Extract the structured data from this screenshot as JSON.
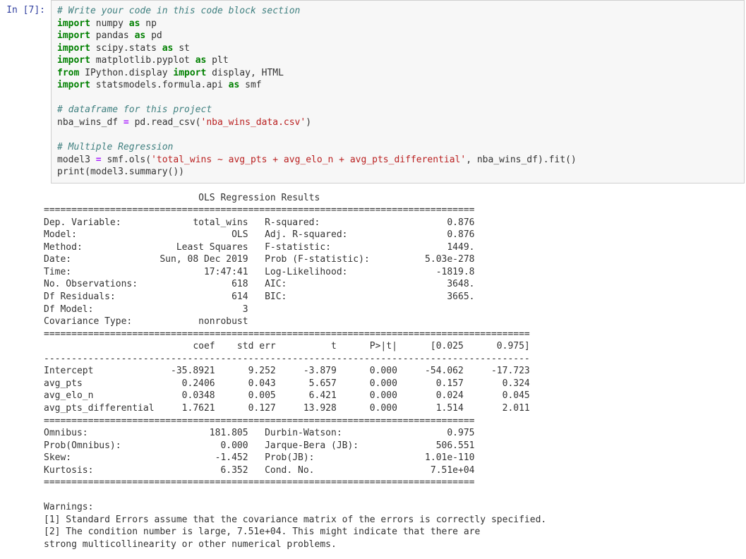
{
  "cell": {
    "prompt": "In [7]:",
    "code": {
      "l1_comment": "# Write your code in this code block section",
      "l2_kw1": "import",
      "l2_mod": "numpy",
      "l2_kw2": "as",
      "l2_alias": "np",
      "l3_kw1": "import",
      "l3_mod": "pandas",
      "l3_kw2": "as",
      "l3_alias": "pd",
      "l4_kw1": "import",
      "l4_mod": "scipy.stats",
      "l4_kw2": "as",
      "l4_alias": "st",
      "l5_kw1": "import",
      "l5_mod": "matplotlib.pyplot",
      "l5_kw2": "as",
      "l5_alias": "plt",
      "l6_kw1": "from",
      "l6_mod": "IPython.display",
      "l6_kw2": "import",
      "l6_names": "display, HTML",
      "l7_kw1": "import",
      "l7_mod": "statsmodels.formula.api",
      "l7_kw2": "as",
      "l7_alias": "smf",
      "l9_comment": "# dataframe for this project",
      "l10_var": "nba_wins_df ",
      "l10_eq": "=",
      "l10_call": " pd.read_csv(",
      "l10_str": "'nba_wins_data.csv'",
      "l10_end": ")",
      "l12_comment": "# Multiple Regression",
      "l13_var": "model3 ",
      "l13_eq": "=",
      "l13_call": " smf.ols(",
      "l13_str": "'total_wins ~ avg_pts + avg_elo_n + avg_pts_differential'",
      "l13_mid": ", nba_wins_df).fit()",
      "l14": "print(model3.summary())"
    }
  },
  "output": {
    "text": "                            OLS Regression Results                            \n==============================================================================\nDep. Variable:             total_wins   R-squared:                       0.876\nModel:                            OLS   Adj. R-squared:                  0.876\nMethod:                 Least Squares   F-statistic:                     1449.\nDate:                Sun, 08 Dec 2019   Prob (F-statistic):          5.03e-278\nTime:                        17:47:41   Log-Likelihood:                -1819.8\nNo. Observations:                 618   AIC:                             3648.\nDf Residuals:                     614   BIC:                             3665.\nDf Model:                           3                                         \nCovariance Type:            nonrobust                                         \n========================================================================================\n                           coef    std err          t      P>|t|      [0.025      0.975]\n----------------------------------------------------------------------------------------\nIntercept              -35.8921      9.252     -3.879      0.000     -54.062     -17.723\navg_pts                  0.2406      0.043      5.657      0.000       0.157       0.324\navg_elo_n                0.0348      0.005      6.421      0.000       0.024       0.045\navg_pts_differential     1.7621      0.127     13.928      0.000       1.514       2.011\n==============================================================================\nOmnibus:                      181.805   Durbin-Watson:                   0.975\nProb(Omnibus):                  0.000   Jarque-Bera (JB):              506.551\nSkew:                          -1.452   Prob(JB):                    1.01e-110\nKurtosis:                       6.352   Cond. No.                     7.51e+04\n==============================================================================\n\nWarnings:\n[1] Standard Errors assume that the covariance matrix of the errors is correctly specified.\n[2] The condition number is large, 7.51e+04. This might indicate that there are\nstrong multicollinearity or other numerical problems."
  },
  "chart_data": {
    "type": "table",
    "title": "OLS Regression Results",
    "model_summary": {
      "Dep. Variable": "total_wins",
      "Model": "OLS",
      "Method": "Least Squares",
      "Date": "Sun, 08 Dec 2019",
      "Time": "17:47:41",
      "No. Observations": 618,
      "Df Residuals": 614,
      "Df Model": 3,
      "Covariance Type": "nonrobust",
      "R-squared": 0.876,
      "Adj. R-squared": 0.876,
      "F-statistic": 1449.0,
      "Prob (F-statistic)": "5.03e-278",
      "Log-Likelihood": -1819.8,
      "AIC": 3648.0,
      "BIC": 3665.0
    },
    "coefficients": {
      "columns": [
        "coef",
        "std err",
        "t",
        "P>|t|",
        "[0.025",
        "0.975]"
      ],
      "rows": [
        {
          "name": "Intercept",
          "coef": -35.8921,
          "std_err": 9.252,
          "t": -3.879,
          "p": 0.0,
          "ci_low": -54.062,
          "ci_high": -17.723
        },
        {
          "name": "avg_pts",
          "coef": 0.2406,
          "std_err": 0.043,
          "t": 5.657,
          "p": 0.0,
          "ci_low": 0.157,
          "ci_high": 0.324
        },
        {
          "name": "avg_elo_n",
          "coef": 0.0348,
          "std_err": 0.005,
          "t": 6.421,
          "p": 0.0,
          "ci_low": 0.024,
          "ci_high": 0.045
        },
        {
          "name": "avg_pts_differential",
          "coef": 1.7621,
          "std_err": 0.127,
          "t": 13.928,
          "p": 0.0,
          "ci_low": 1.514,
          "ci_high": 2.011
        }
      ]
    },
    "diagnostics": {
      "Omnibus": 181.805,
      "Prob(Omnibus)": 0.0,
      "Skew": -1.452,
      "Kurtosis": 6.352,
      "Durbin-Watson": 0.975,
      "Jarque-Bera (JB)": 506.551,
      "Prob(JB)": "1.01e-110",
      "Cond. No.": "7.51e+04"
    },
    "warnings": [
      "Standard Errors assume that the covariance matrix of the errors is correctly specified.",
      "The condition number is large, 7.51e+04. This might indicate that there are strong multicollinearity or other numerical problems."
    ]
  }
}
